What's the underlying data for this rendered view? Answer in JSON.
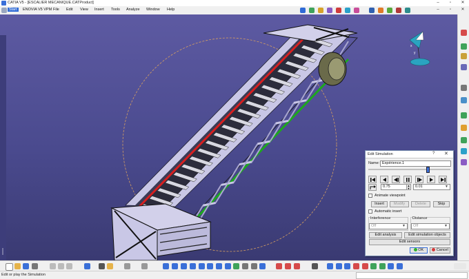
{
  "window": {
    "title": "CATIA V5 - [ESCALIER MECANIQUE.CATProduct]",
    "controls": {
      "minimize": "–",
      "maximize": "▫",
      "close": "✕"
    }
  },
  "menu": {
    "items": [
      "Start",
      "ENOVIA V5 VPM",
      "File",
      "Edit",
      "View",
      "Insert",
      "Tools",
      "Analyze",
      "Window",
      "Help"
    ],
    "doc_controls": {
      "minimize": "–",
      "restore": "▫",
      "close": "✕"
    }
  },
  "dialog": {
    "title": "Edit Simulation",
    "help": "?",
    "close": "✕",
    "name_label": "Name:",
    "name_value": "Expérience.1",
    "step_value": "0.75",
    "step_size": "0.01",
    "animate_viewpoint": "Animate viewpoint",
    "insert": "Insert",
    "modify": "Modify",
    "delete": "Delete",
    "skip": "Skip",
    "automatic_insert": "Automatic insert",
    "interference_label": "Interference",
    "interference_value": "Off",
    "distance_label": "Distance",
    "distance_value": "Off",
    "edit_analysis": "Edit analysis",
    "edit_simulation_objects": "Edit simulation objects",
    "edit_sensors": "Edit sensors",
    "ok": "OK",
    "cancel": "Cancel",
    "slider_position": 0.72
  },
  "status": {
    "message": "Edit or play the Simulation"
  },
  "colors": {
    "viewport_top": "#5d5aa2",
    "viewport_bottom": "#3a3a72",
    "frame": "#c9c7e6",
    "steps": "#d8d8e2",
    "rail_red": "#d61f1f",
    "rail_green": "#1ea81e",
    "accent": "#2f6bd6"
  },
  "icons": [
    "catia-logo-icon",
    "compass-icon",
    "play-icon",
    "stop-icon"
  ]
}
